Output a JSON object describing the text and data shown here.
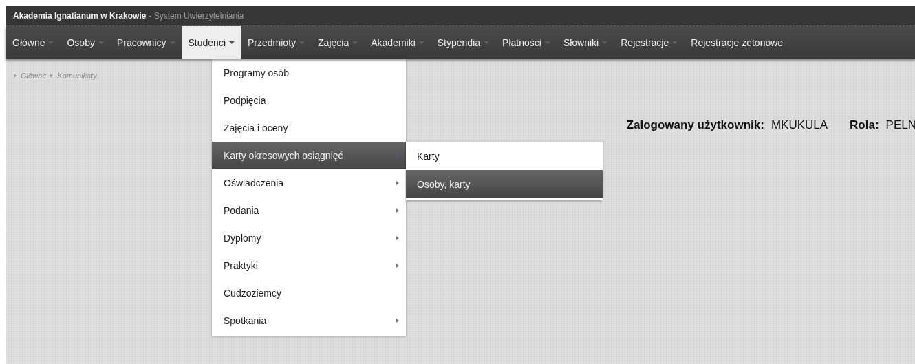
{
  "header": {
    "title": "Akademia Ignatianum w Krakowie",
    "subtitle": "- System Uwierzytelniania"
  },
  "nav": [
    {
      "label": "Główne",
      "selected": false
    },
    {
      "label": "Osoby",
      "selected": false
    },
    {
      "label": "Pracownicy",
      "selected": false
    },
    {
      "label": "Studenci",
      "selected": true
    },
    {
      "label": "Przedmioty",
      "selected": false
    },
    {
      "label": "Zajęcia",
      "selected": false
    },
    {
      "label": "Akademiki",
      "selected": false
    },
    {
      "label": "Stypendia",
      "selected": false
    },
    {
      "label": "Płatności",
      "selected": false
    },
    {
      "label": "Słowniki",
      "selected": false
    },
    {
      "label": "Rejestracje",
      "selected": false
    },
    {
      "label": "Rejestracje żetonowe",
      "selected": false
    }
  ],
  "breadcrumb": [
    "Główne",
    "Komunikaty"
  ],
  "dropdown": [
    {
      "label": "Programy osób",
      "selected": false,
      "has_submenu": false
    },
    {
      "label": "Podpięcia",
      "selected": false,
      "has_submenu": false
    },
    {
      "label": "Zajęcia i oceny",
      "selected": false,
      "has_submenu": false
    },
    {
      "label": "Karty okresowych osiągnięć",
      "selected": true,
      "has_submenu": true,
      "children": [
        {
          "label": "Karty",
          "selected": false
        },
        {
          "label": "Osoby, karty",
          "selected": true
        }
      ]
    },
    {
      "label": "Oświadczenia",
      "selected": false,
      "has_submenu": true
    },
    {
      "label": "Podania",
      "selected": false,
      "has_submenu": true
    },
    {
      "label": "Dyplomy",
      "selected": false,
      "has_submenu": true
    },
    {
      "label": "Praktyki",
      "selected": false,
      "has_submenu": true
    },
    {
      "label": "Cudzoziemcy",
      "selected": false,
      "has_submenu": false
    },
    {
      "label": "Spotkania",
      "selected": false,
      "has_submenu": true
    }
  ],
  "user_info": {
    "user_label": "Zalogowany użytkownik:",
    "user": "MKUKULA",
    "role_label": "Rola:",
    "role": "PELN"
  }
}
